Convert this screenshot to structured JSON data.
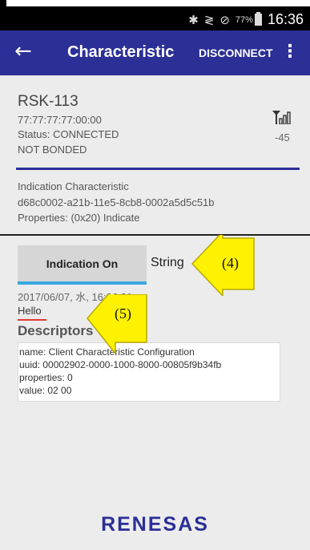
{
  "status_bar": {
    "icons": [
      "bluetooth-icon",
      "no-vibrate-icon",
      "do-not-disturb-icon"
    ],
    "battery": "77%",
    "time": "16:36"
  },
  "app_bar": {
    "title": "Characteristic",
    "disconnect_label": "DISCONNECT",
    "color": "#2b2f96"
  },
  "device": {
    "name": "RSK-113",
    "address": "77:77:77:77:00:00",
    "status": "Status: CONNECTED",
    "bond": "NOT BONDED",
    "rssi": "-45"
  },
  "characteristic": {
    "name": "Indication Characteristic",
    "uuid": "d68c0002-a21b-11e5-8cb8-0002a5d5c51b",
    "properties": "Properties: (0x20) Indicate"
  },
  "controls": {
    "indication_button": "Indication On",
    "format_label": "String",
    "timestamp": "2017/06/07, 水, 16:36:01",
    "value": "Hello"
  },
  "descriptors": {
    "title": "Descriptors",
    "lines": [
      "name: Client Characteristic Configuration",
      "uuid: 00002902-0000-1000-8000-00805f9b34fb",
      "properties: 0",
      "value: 02 00"
    ]
  },
  "callouts": [
    "(4)",
    "(5)"
  ],
  "brand": "RENESAS",
  "colors": {
    "accent": "#2b2f96",
    "button_underline": "#3aa6e0",
    "value_underline": "#e53935",
    "callout": "#fff200"
  }
}
